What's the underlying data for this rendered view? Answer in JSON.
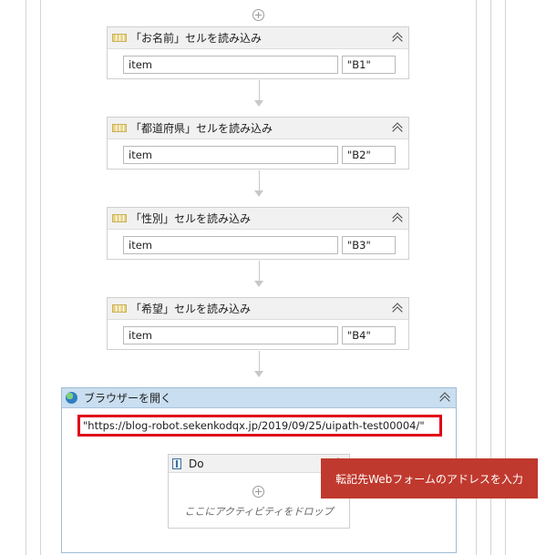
{
  "activities": [
    {
      "title": "「お名前」セルを読み込み",
      "field_item": "item",
      "field_cell": "\"B1\""
    },
    {
      "title": "「都道府県」セルを読み込み",
      "field_item": "item",
      "field_cell": "\"B2\""
    },
    {
      "title": "「性別」セルを読み込み",
      "field_item": "item",
      "field_cell": "\"B3\""
    },
    {
      "title": "「希望」セルを読み込み",
      "field_item": "item",
      "field_cell": "\"B4\""
    }
  ],
  "browser": {
    "title": "ブラウザーを開く",
    "url": "\"https://blog-robot.sekenkodqx.jp/2019/09/25/uipath-test00004/\"",
    "do_title": "Do",
    "drop_hint": "ここにアクティビティをドロップ"
  },
  "callout": {
    "text": "転記先Webフォームのアドレスを入力"
  },
  "colors": {
    "highlight": "#e0001a",
    "callout_bg": "#c0392e",
    "browser_header": "#c9def0"
  }
}
